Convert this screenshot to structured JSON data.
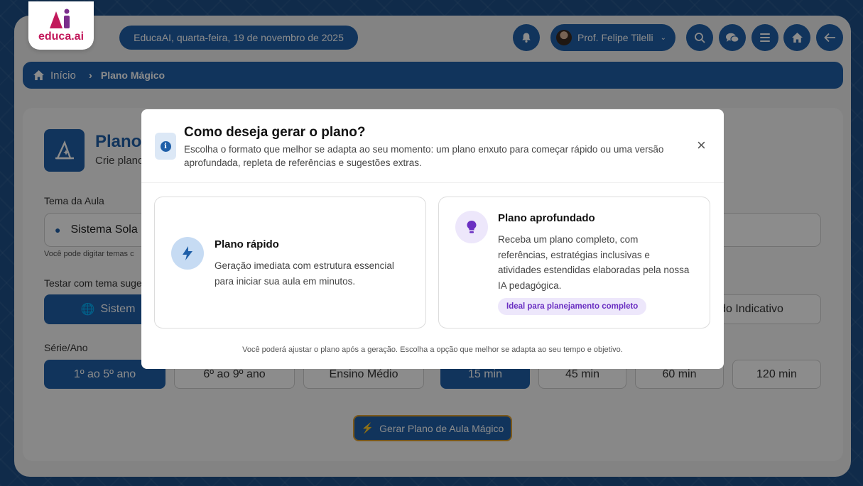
{
  "app": {
    "logo_text": "educa.ai"
  },
  "header": {
    "date": "EducaAI, quarta-feira, 19 de novembro de 2025",
    "user_name": "Prof. Felipe Tilelli",
    "icons": [
      "bell-icon",
      "search-icon",
      "chat-icon",
      "menu-icon",
      "home-icon",
      "back-arrow-icon"
    ]
  },
  "breadcrumb": {
    "home": "Início",
    "current": "Plano Mágico"
  },
  "page": {
    "title": "Plano",
    "subtitle": "Crie plano",
    "theme_label": "Tema da Aula",
    "theme_value": "Sistema Sola",
    "theme_hint": "Você pode digitar temas c",
    "suggest_label": "Testar com tema suge",
    "suggest_left": "Sistem",
    "suggest_right": "do Indicativo",
    "grade_label": "Série/Ano",
    "grades": [
      "1º ao 5º ano",
      "6º ao 9º ano",
      "Ensino Médio"
    ],
    "durations": [
      "15 min",
      "45 min",
      "60 min",
      "120 min"
    ],
    "generate_button": "Gerar Plano de Aula Mágico"
  },
  "modal": {
    "title": "Como deseja gerar o plano?",
    "description": "Escolha o formato que melhor se adapta ao seu momento: um plano enxuto para começar rápido ou uma versão aprofundada, repleta de referências e sugestões extras.",
    "close": "×",
    "quick": {
      "title": "Plano rápido",
      "description": "Geração imediata com estrutura essencial para iniciar sua aula em minutos."
    },
    "deep": {
      "title": "Plano aprofundado",
      "description": "Receba um plano completo, com referências, estratégias inclusivas e atividades estendidas elaboradas pela nossa IA pedagógica.",
      "badge": "Ideal para planejamento completo"
    },
    "footer": "Você poderá ajustar o plano após a geração. Escolha a opção que melhor se adapta ao seu tempo e objetivo."
  },
  "colors": {
    "primary": "#1f5fa8",
    "accent_purple": "#6a2fc2",
    "brand_pink": "#c2185b"
  }
}
